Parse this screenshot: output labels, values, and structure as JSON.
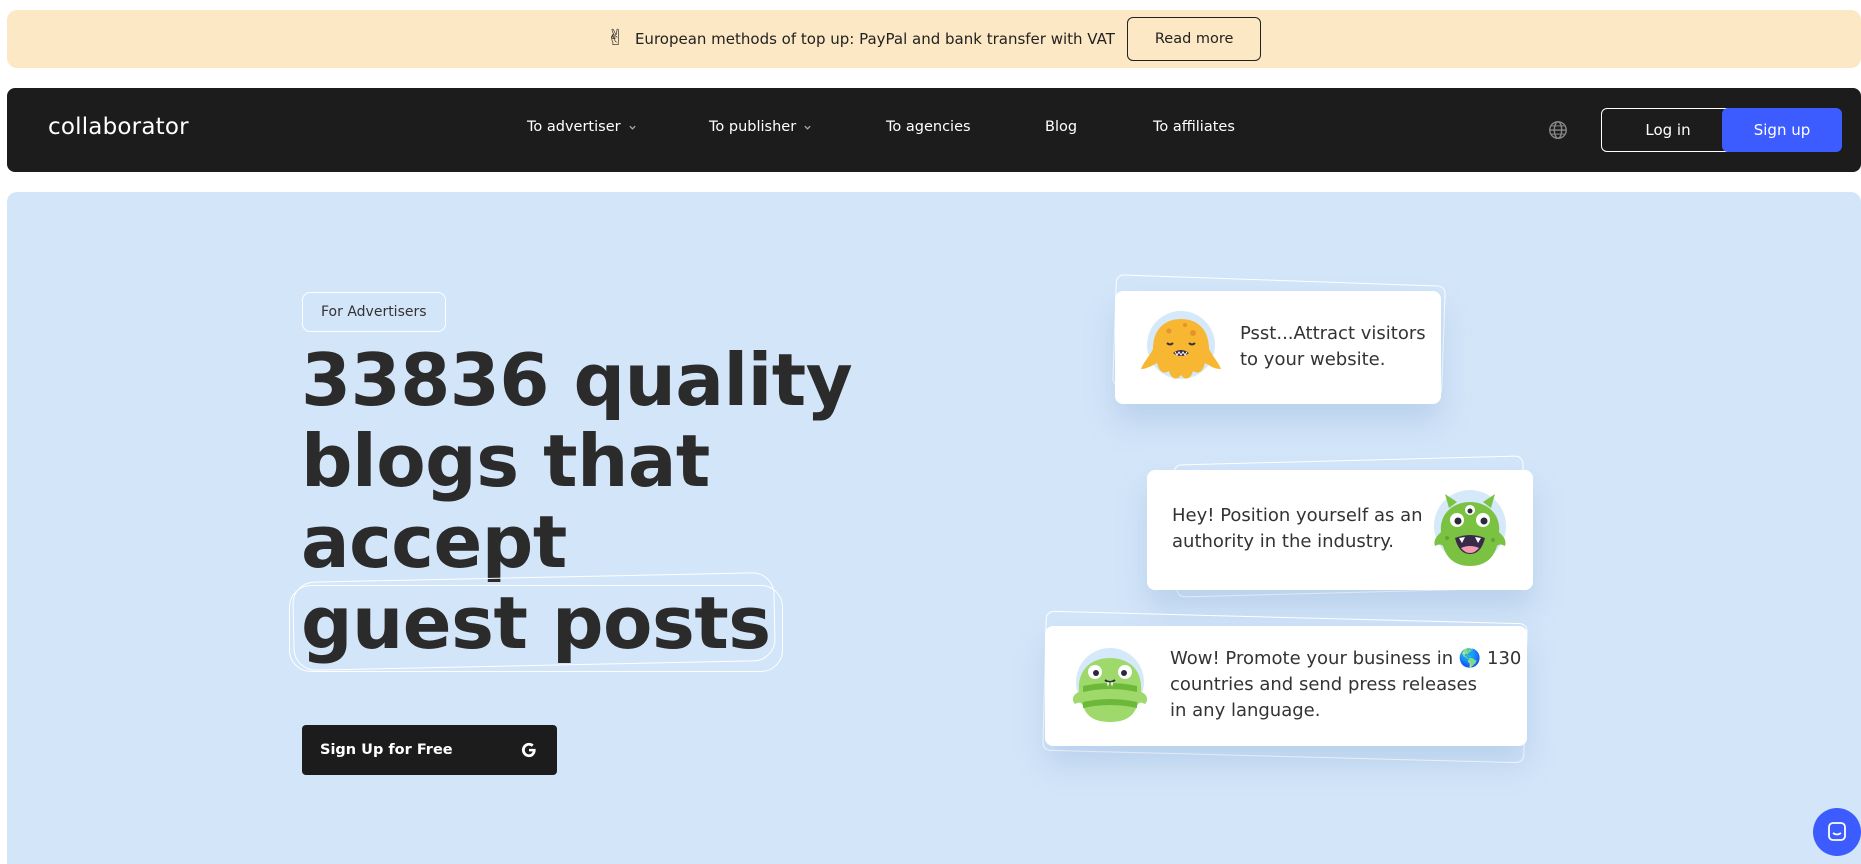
{
  "promo": {
    "icon": "victory-hand-emoji",
    "emoji": "✌",
    "text": "European methods of top up: PayPal and bank transfer with VAT",
    "button": "Read more"
  },
  "nav": {
    "logo": "collaborator",
    "links": [
      {
        "label": "To advertiser",
        "dropdown": true
      },
      {
        "label": "To publisher",
        "dropdown": true
      },
      {
        "label": "To agencies",
        "dropdown": false
      },
      {
        "label": "Blog",
        "dropdown": false
      },
      {
        "label": "To affiliates",
        "dropdown": false
      }
    ],
    "login": "Log in",
    "signup": "Sign up"
  },
  "hero": {
    "pill": "For Advertisers",
    "headline": [
      "33836 quality",
      "blogs that",
      "accept",
      "guest posts"
    ],
    "cta": "Sign Up for Free"
  },
  "cards": [
    {
      "text_lines": [
        "Psst...Attract visitors",
        "to your website."
      ],
      "mascot": "orange-octopus-mascot"
    },
    {
      "text_lines": [
        "Hey! Position yourself as an",
        "authority in the industry."
      ],
      "mascot": "green-three-eyed-monster-mascot"
    },
    {
      "text_lines": [
        "Wow! Promote your business in 🌎 130",
        "countries and send press releases",
        "in any language."
      ],
      "mascot": "green-striped-monster-mascot"
    }
  ],
  "colors": {
    "promo_bg": "#fce8c4",
    "nav_bg": "#1c1c1c",
    "accent": "#3d5cff",
    "hero_bg": "#d3e5f9"
  }
}
